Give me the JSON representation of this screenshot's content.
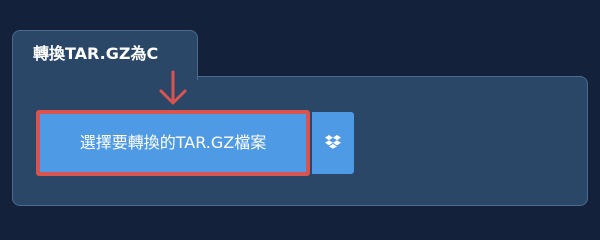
{
  "tab": {
    "title": "轉換TAR.GZ為C"
  },
  "upload": {
    "choose_file_label": "選擇要轉換的TAR.GZ檔案"
  },
  "icons": {
    "arrow": "arrow-down-icon",
    "dropbox": "dropbox-icon"
  },
  "colors": {
    "page_background": "#13223a",
    "panel": "#2b4768",
    "panel_border": "#4a6a8f",
    "button": "#4f9ae4",
    "highlight": "#d9534f"
  }
}
